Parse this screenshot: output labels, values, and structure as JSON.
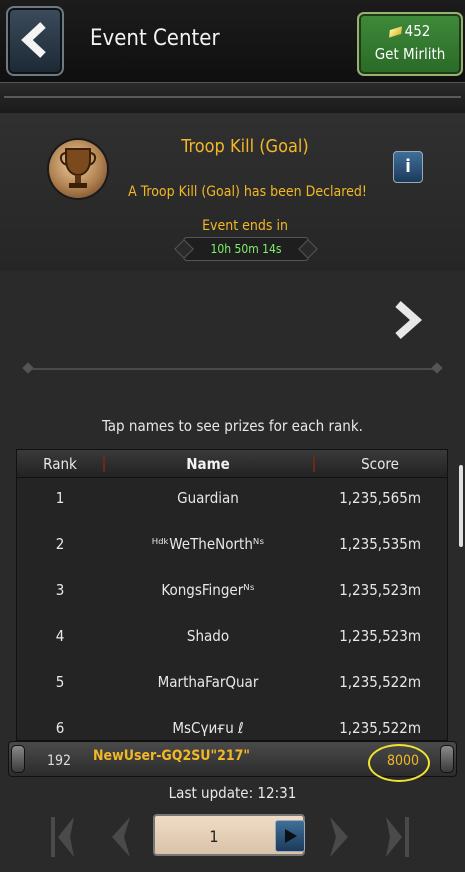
{
  "header": {
    "title": "Event Center",
    "currency_amount": "452",
    "get_currency_label": "Get Mirlith"
  },
  "event": {
    "title": "Troop Kill (Goal)",
    "description": "A Troop Kill (Goal) has been Declared!",
    "ends_label": "Event ends in",
    "time_remaining": "10h 50m 14s",
    "info_label": "i"
  },
  "hint": "Tap names to see prizes for each rank.",
  "leaderboard": {
    "headers": {
      "rank": "Rank",
      "name": "Name",
      "score": "Score"
    },
    "rows": [
      {
        "rank": "1",
        "name": "Guardian",
        "score": "1,235,565m"
      },
      {
        "rank": "2",
        "name": "ᴴᵈᵏWeTheNorthᴺˢ",
        "score": "1,235,535m"
      },
      {
        "rank": "3",
        "name": "KongsFingerᴺˢ",
        "score": "1,235,523m"
      },
      {
        "rank": "4",
        "name": "Shado",
        "score": "1,235,523m"
      },
      {
        "rank": "5",
        "name": "MarthaFarQuar",
        "score": "1,235,522m"
      },
      {
        "rank": "6",
        "name": "MsCүиғu ℓ",
        "score": "1,235,522m"
      }
    ]
  },
  "my_rank": {
    "rank": "192",
    "name": "NewUser-GQ2SU\"217\"",
    "score": "8000"
  },
  "last_update": "Last update: 12:31",
  "pager": {
    "current_page": "1"
  },
  "colors": {
    "gold_text": "#f3b826",
    "timer_text": "#7ef06a",
    "currency_button": "#3f8a3a",
    "highlight": "#f2e330"
  }
}
